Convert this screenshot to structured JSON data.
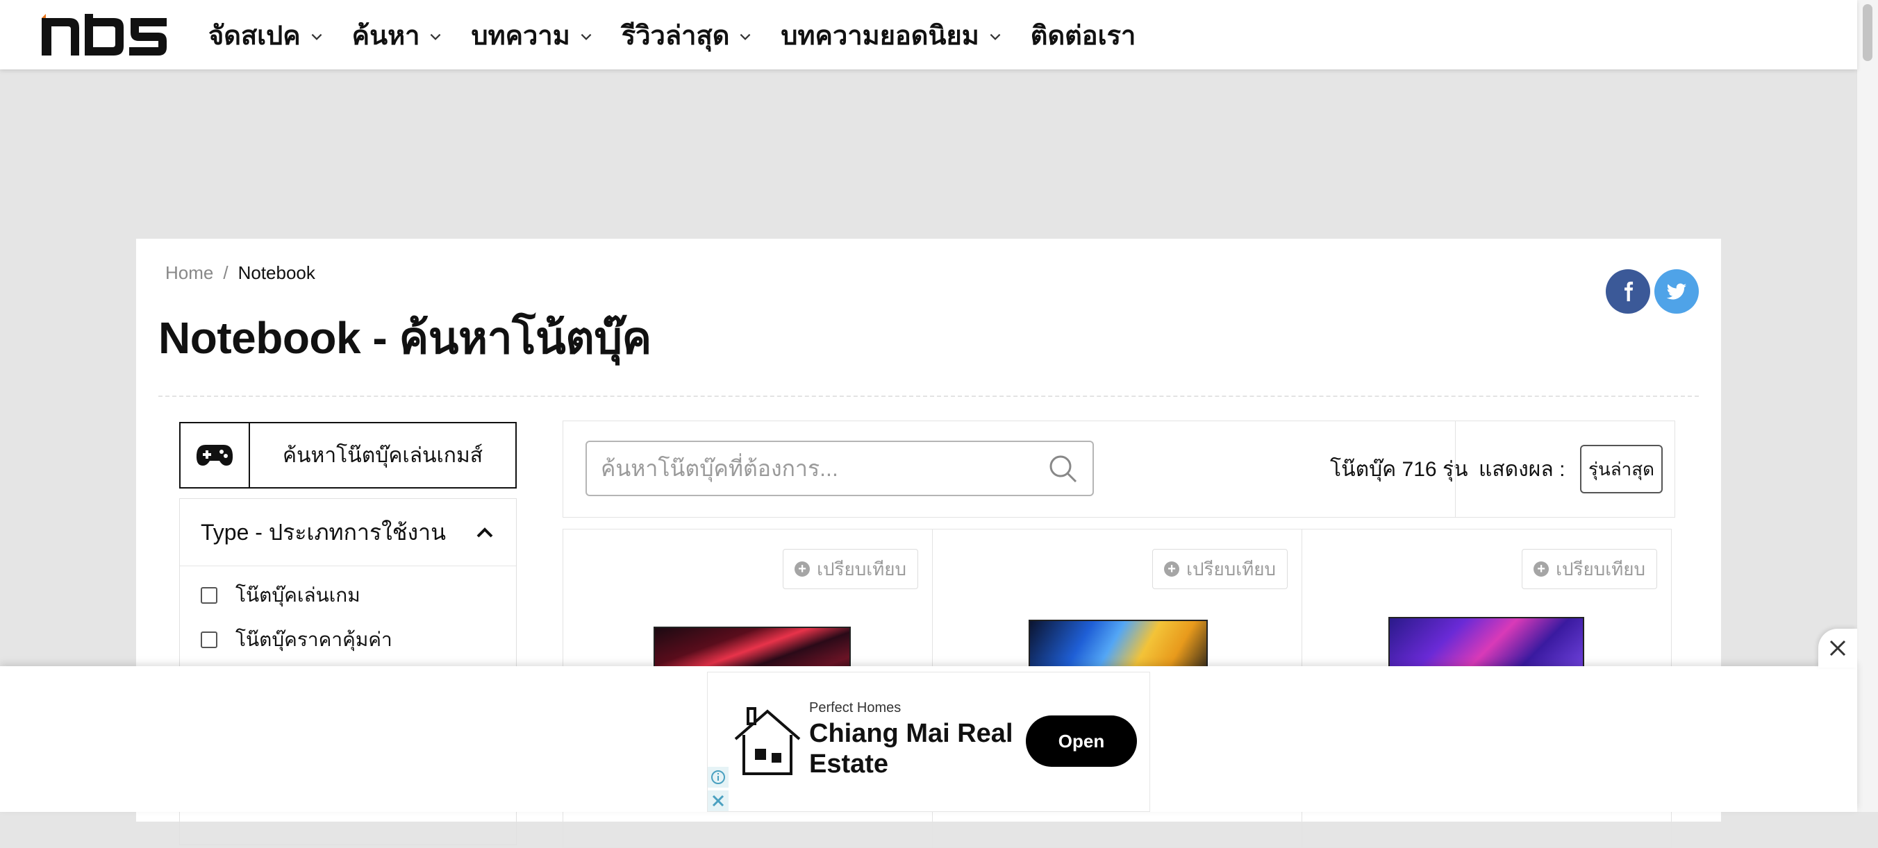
{
  "nav": {
    "logo_text": "NBS",
    "menu": [
      {
        "label": "จัดสเปค",
        "has_dropdown": true
      },
      {
        "label": "ค้นหา",
        "has_dropdown": true
      },
      {
        "label": "บทความ",
        "has_dropdown": true
      },
      {
        "label": "รีวิวล่าสุด",
        "has_dropdown": true
      },
      {
        "label": "บทความยอดนิยม",
        "has_dropdown": true
      },
      {
        "label": "ติดต่อเรา",
        "has_dropdown": false
      }
    ]
  },
  "breadcrumb": {
    "home": "Home",
    "separator": "/",
    "current": "Notebook"
  },
  "page": {
    "title": "Notebook - ค้นหาโน้ตบุ๊ค"
  },
  "social": {
    "facebook_icon": "facebook-icon",
    "twitter_icon": "twitter-icon",
    "facebook_color": "#3b5998",
    "twitter_color": "#4fa3e8"
  },
  "sidebar": {
    "game_button_label": "ค้นหาโน๊ตบุ๊คเล่นเกมส์",
    "game_icon": "gamepad-icon",
    "filter": {
      "title": "Type - ประเภทการใช้งาน",
      "expanded": true,
      "options": [
        {
          "label": "โน๊ตบุ๊คเล่นเกม",
          "checked": false
        },
        {
          "label": "โน๊ตบุ๊คราคาคุ้มค่า",
          "checked": false
        }
      ]
    }
  },
  "toolbar": {
    "search_placeholder": "ค้นหาโน๊ตบุ๊คที่ต้องการ...",
    "count_label": "โน๊ตบุ๊ค 716 รุ่น",
    "sort_label": "แสดงผล :",
    "sort_value": "รุ่นล่าสุด"
  },
  "products": [
    {
      "compare_label": "เปรียบเทียบ"
    },
    {
      "compare_label": "เปรียบเทียบ"
    },
    {
      "compare_label": "เปรียบเทียบ"
    }
  ],
  "ad": {
    "advertiser": "Perfect Homes",
    "headline": "Chiang Mai Real Estate",
    "cta": "Open"
  }
}
